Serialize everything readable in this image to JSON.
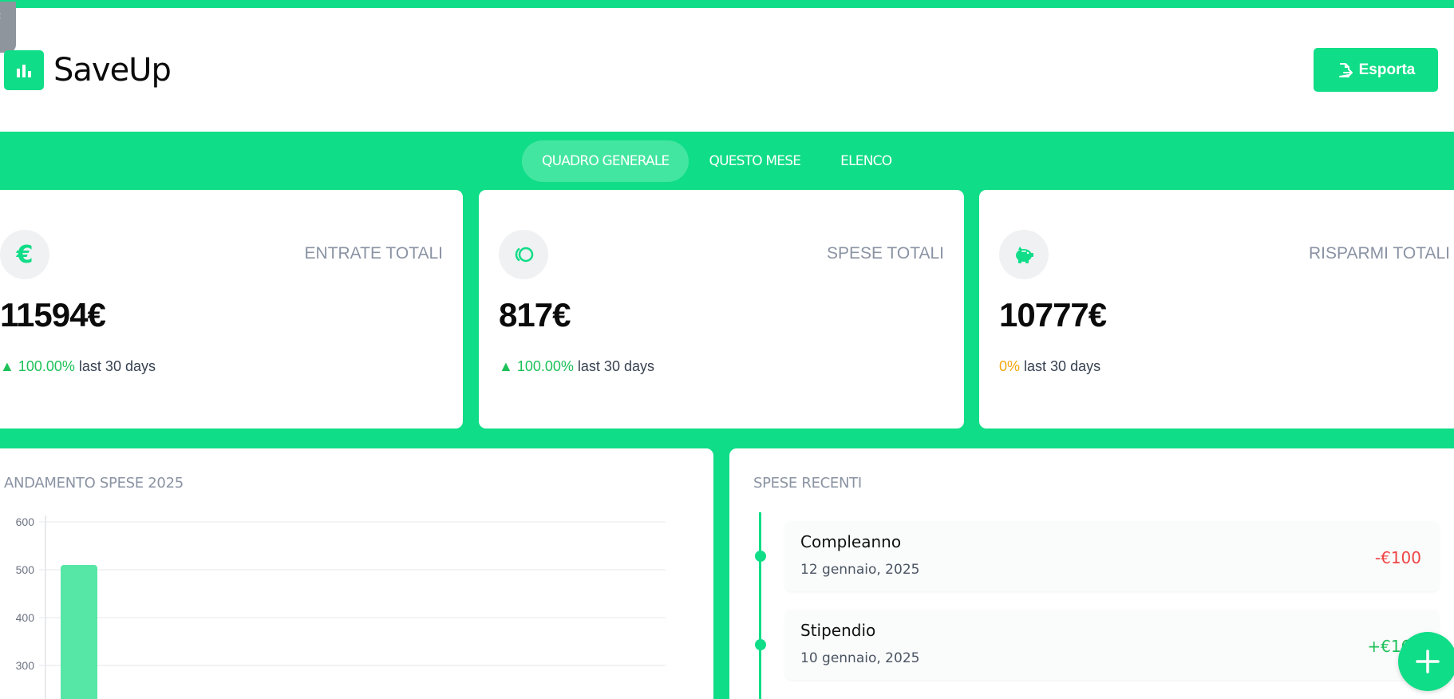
{
  "app": {
    "name": "SaveUp",
    "logo_icon": "bar-chart-icon",
    "corner_tab_glyph": "‹"
  },
  "header": {
    "export_label": "Esporta",
    "export_icon": "file-export-icon"
  },
  "tabs": [
    {
      "label": "QUADRO GENERALE",
      "active": true
    },
    {
      "label": "QUESTO MESE",
      "active": false
    },
    {
      "label": "ELENCO",
      "active": false
    }
  ],
  "stats": [
    {
      "icon": "euro-icon",
      "icon_glyph": "€",
      "label": "ENTRATE TOTALI",
      "value": "11594€",
      "change_arrow": "▲",
      "change_pct": "100.00%",
      "change_suffix": "last 30 days"
    },
    {
      "icon": "coins-icon",
      "label": "SPESE TOTALI",
      "value": "817€",
      "change_arrow": "▲",
      "change_pct": "100.00%",
      "change_suffix": "last 30 days"
    },
    {
      "icon": "piggy-bank-icon",
      "label": "RISPARMI TOTALI",
      "value": "10777€",
      "change_arrow": "",
      "change_pct": "0%",
      "change_suffix": "last 30 days"
    }
  ],
  "trend_panel": {
    "title": "ANDAMENTO SPESE 2025"
  },
  "chart_data": {
    "type": "bar",
    "title": "ANDAMENTO SPESE 2025",
    "yticks": [
      "600",
      "500",
      "400",
      "300"
    ],
    "ylim": [
      0,
      600
    ],
    "series": [
      {
        "values": [
          510
        ]
      }
    ],
    "grid": true,
    "colors": {
      "bar": "#56e6a6",
      "grid": "#e5e7eb",
      "axis": "#d1d5db"
    }
  },
  "recent_panel": {
    "title": "SPESE RECENTI",
    "items": [
      {
        "title": "Compleanno",
        "date": "12 gennaio, 2025",
        "amount": "-€100",
        "kind": "expense"
      },
      {
        "title": "Stipendio",
        "date": "10 gennaio, 2025",
        "amount": "+€165",
        "kind": "income"
      }
    ]
  },
  "fab": {
    "icon": "plus-icon"
  },
  "colors": {
    "accent": "#10dd87",
    "tab_active": "#43e6a0",
    "positive": "#1ec15a",
    "negative": "#ef4444",
    "neutral_change": "#f5a70e",
    "muted_text": "#8a93a3"
  }
}
